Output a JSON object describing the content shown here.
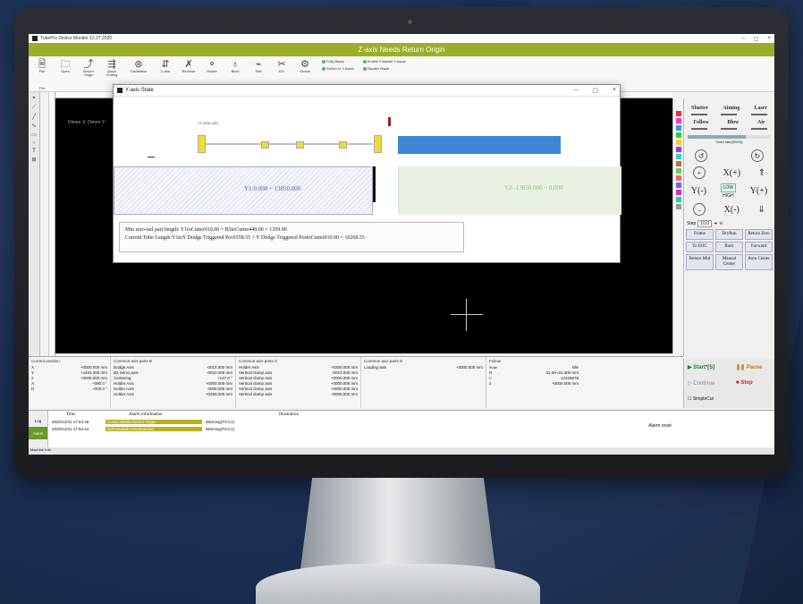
{
  "app": {
    "window_title": "TubePro Device Monitor 12.27.2020",
    "alarm_banner": "Z-axis Needs Return Origin"
  },
  "ribbon": {
    "buttons": [
      {
        "icon": "file-icon",
        "label": "File"
      },
      {
        "icon": "open-icon",
        "label": "Open"
      },
      {
        "icon": "return-icon",
        "label": "Return Origin"
      },
      {
        "icon": "quick-icon",
        "label": "Quick Cutting"
      },
      {
        "icon": "oscillation-icon",
        "label": "Oscillation"
      },
      {
        "icon": "z-axis-icon",
        "label": "Z-axis"
      },
      {
        "icon": "reverse-icon",
        "label": "Reverse"
      },
      {
        "icon": "holder-icon",
        "label": "Holder"
      },
      {
        "icon": "blow-icon",
        "label": "Blow"
      },
      {
        "icon": "test-icon",
        "label": "Test"
      },
      {
        "icon": "ioc-icon",
        "label": "IOC"
      },
      {
        "icon": "global-icon",
        "label": "Global"
      }
    ],
    "group_label": "File",
    "options": [
      "Fully Blade",
      "Switch to Y-blade",
      "Enable Fullplate Y-blade",
      "Disable Blade"
    ]
  },
  "canvas": {
    "label": "Dimen X: Dimen Y:"
  },
  "dialog": {
    "title": "Y-axis State",
    "top_label": "Y1:4491.450",
    "zone1": "Y1:0.000 ~ 13850.000",
    "zone2": "Y2:-13850.000 ~ 0.000",
    "info_line1": "Min zero-tail part length: Y1toCutter910.00 + B3toCutter449.00 = 1359.00",
    "info_line2": "Current Tube Length:Y1toY Dodge Triggered Pos9358.55 + Y Dodge Triggered PostoCutter910.00 = 10268.55"
  },
  "right_panel": {
    "top_buttons": [
      "Shutter",
      "Aiming",
      "Laser",
      "Follow",
      "Blow",
      "Air"
    ],
    "power_label": "Feed rate(300%)",
    "x_plus": "X(+)",
    "x_minus": "X(-)",
    "y_minus": "Y(-)",
    "y_plus": "Y(+)",
    "speed_low": "LOW",
    "speed_high": "HIGH",
    "step_label": "Step",
    "step_value": "10.0",
    "process_buttons": [
      {
        "label": "Frame"
      },
      {
        "label": "DryRun"
      },
      {
        "label": "Return Zero"
      },
      {
        "label": "To EOC"
      },
      {
        "label": "Back"
      },
      {
        "label": "Forward"
      },
      {
        "label": "Return Mid"
      },
      {
        "label": "Manual Center"
      },
      {
        "label": "Auto Center"
      }
    ],
    "start": "Start*[S]",
    "pause": "Pause",
    "continue": "Continue",
    "stop": "Stop",
    "simplecut": "SimpleCut"
  },
  "status": {
    "position": {
      "title": "Current position",
      "rows": [
        {
          "axis": "X",
          "value": "+0000.000 mm"
        },
        {
          "axis": "Y",
          "value": "+4491.450 mm"
        },
        {
          "axis": "Z",
          "value": "+0000.000 mm"
        },
        {
          "axis": "A",
          "value": "+090.0 °"
        },
        {
          "axis": "B",
          "value": "+000.0 °"
        }
      ]
    },
    "cpanel_b": {
      "title": "Common axis parts B",
      "rows": [
        {
          "k": "Dodge Axis",
          "v": "-0010.000 mm"
        },
        {
          "k": "B2 Servo axis",
          "v": "-0010.000 mm"
        },
        {
          "k": "Centering",
          "v": "+147.0 °"
        },
        {
          "k": "Holder Axis",
          "v": "+0000.000 mm"
        },
        {
          "k": "Holder Axis",
          "v": "0000.000 mm"
        },
        {
          "k": "Holder Axis",
          "v": "+0250.000 mm"
        }
      ]
    },
    "cpanel_c": {
      "title": "Common axis parts C",
      "rows": [
        {
          "k": "Holder Axis",
          "v": "+0250.000 mm"
        },
        {
          "k": "Vertical clamp axis",
          "v": "-0010.000 mm"
        },
        {
          "k": "Vertical clamp axis",
          "v": "+0000.000 mm"
        },
        {
          "k": "Vertical clamp axis",
          "v": "+0000.000 mm"
        },
        {
          "k": "Vertical clamp axis",
          "v": "+0000.000 mm"
        },
        {
          "k": "Vertical clamp axis",
          "v": "+0000.000 mm"
        }
      ]
    },
    "cpanel_d": {
      "title": "Common axis parts D",
      "rows": [
        {
          "k": "Loading axis",
          "v": "+0000.000 mm"
        }
      ]
    },
    "follow": {
      "title": "Follow",
      "rows": [
        {
          "k": "State",
          "v": "Idle"
        },
        {
          "k": "H",
          "v": "01.00+24.000 mm"
        },
        {
          "k": "C",
          "v": "12345678"
        },
        {
          "k": "Z",
          "v": "+0000.000 mm"
        }
      ]
    }
  },
  "log": {
    "tabs": [
      "Log",
      "Alarm"
    ],
    "headers": [
      "Time",
      "Alarm information",
      "Illustration"
    ],
    "rows": [
      {
        "time": "2020/12/31 17:54:48",
        "info": "Z-axis Needs Return Origin",
        "illustration": "Warning(TS:C1)"
      },
      {
        "time": "2020/12/31 17:54:44",
        "info": "Soft Module Unconnected",
        "illustration": "Warning(TS:C1)"
      }
    ],
    "alarm_reset": "Alarm reset"
  },
  "statusbar": "Machine Info",
  "colors": {
    "banner": "#9cae28",
    "tube_bar": "#3d88d6",
    "gripper": "#eedc3a"
  }
}
